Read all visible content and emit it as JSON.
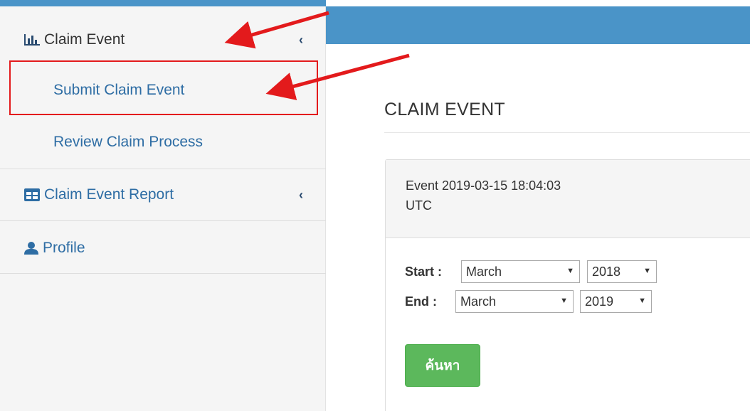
{
  "sidebar": {
    "items": [
      {
        "label": "Claim Event",
        "icon": "bar-chart-icon",
        "expanded": true
      },
      {
        "label": "Claim Event Report",
        "icon": "table-icon"
      },
      {
        "label": "Profile",
        "icon": "user-icon"
      }
    ],
    "subitems": [
      {
        "label": "Submit Claim Event"
      },
      {
        "label": "Review Claim Process"
      }
    ]
  },
  "main": {
    "title": "CLAIM EVENT",
    "panel": {
      "event_line1": "Event 2019-03-15 18:04:03",
      "event_line2": "UTC"
    },
    "filters": {
      "start_label": "Start :",
      "start_month": "March",
      "start_year": "2018",
      "end_label": "End :",
      "end_month": "March",
      "end_year": "2019"
    },
    "search_button": "ค้นหา"
  },
  "colors": {
    "brand_bar": "#4a94c8",
    "link": "#2e6da4",
    "success": "#5cb85c",
    "annotation": "#e31a1c"
  }
}
